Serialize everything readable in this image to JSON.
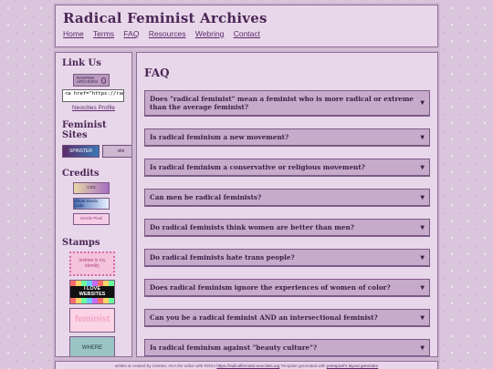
{
  "header": {
    "title": "Radical Feminist Archives",
    "nav": [
      "Home",
      "Terms",
      "FAQ",
      "Resources",
      "Webring",
      "Contact"
    ]
  },
  "sidebar": {
    "link_us": {
      "heading": "Link Us",
      "button_text": "RADFEM ARCHIVES",
      "code_value": "<a href=\"https://radicalfeminist",
      "neocities_link": "Neocities Profile"
    },
    "feminist_sites": {
      "heading": "Feminist Sites",
      "buttons": [
        "SPINSTER",
        "site"
      ]
    },
    "credits": {
      "heading": "Credits",
      "buttons": [
        "CSS",
        "Visual Studio Code",
        "Gentle Pixel"
      ]
    },
    "stamps": {
      "heading": "Stamps",
      "items": [
        "lesbian is my identity",
        "I LOVE WEBSITES",
        "feminist",
        "WHERE"
      ]
    }
  },
  "main": {
    "title": "FAQ",
    "faqs": [
      "Does \"radical feminist\" mean a feminist who is more radical or extreme than the average feminist?",
      "Is radical feminism a new movement?",
      "Is radical feminism a conservative or religious movement?",
      "Can men be radical feminists?",
      "Do radical feminists think women are better than men?",
      "Do radical feminists hate trans people?",
      "Does radical feminism ignore the experiences of women of color?",
      "Can you be a radical feminist AND an intersectional feminist?",
      "Is radical feminism against \"beauty culture\"?"
    ],
    "arrow_icon": "▼"
  },
  "footer": {
    "text": "written & created by Celeste, AKA the editor with ROSA",
    "link1": "https://radicalfeminist.neocities.org",
    "middle": "Template generated with",
    "link2": "petrapixel's layout generator"
  }
}
